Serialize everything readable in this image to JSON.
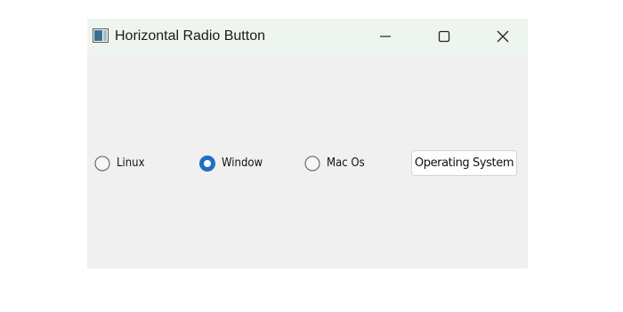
{
  "window": {
    "title": "Horizontal Radio Button"
  },
  "radios": [
    {
      "label": "Linux",
      "checked": false
    },
    {
      "label": "Window",
      "checked": true
    },
    {
      "label": "Mac Os",
      "checked": false
    }
  ],
  "button": {
    "label": "Operating System"
  },
  "colors": {
    "accent": "#1f6fc2",
    "window_bg": "#f0f0f0",
    "titlebar_bg": "#eef5ee"
  },
  "icons": {
    "app": "app-window-icon",
    "minimize": "minimize-icon",
    "maximize": "maximize-icon",
    "close": "close-icon"
  }
}
